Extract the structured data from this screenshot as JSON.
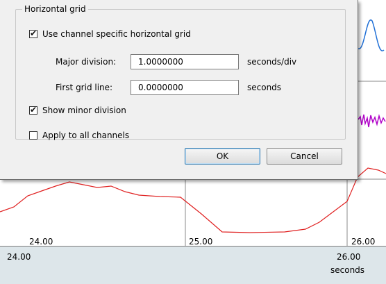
{
  "dialog": {
    "group_title": "Horizontal grid",
    "use_channel_specific": {
      "label": "Use channel specific horizontal grid",
      "checked": true
    },
    "major_division": {
      "label": "Major division:",
      "value": "1.0000000",
      "unit": "seconds/div"
    },
    "first_grid_line": {
      "label": "First grid line:",
      "value": "0.0000000",
      "unit": "seconds"
    },
    "show_minor_division": {
      "label": "Show minor division",
      "checked": true
    },
    "apply_all_channels": {
      "label": "Apply to all channels",
      "checked": false
    },
    "ok_label": "OK",
    "cancel_label": "Cancel"
  },
  "plot": {
    "ticks_inner": [
      "24.00",
      "25.00",
      "26.00"
    ],
    "axis_start": "24.00",
    "axis_end": "26.00",
    "axis_unit": "seconds",
    "colors": {
      "channel_1": "#1f6fd6",
      "channel_2": "#b000c8",
      "channel_3": "#e02020",
      "gridline": "#8a8a8a"
    }
  }
}
